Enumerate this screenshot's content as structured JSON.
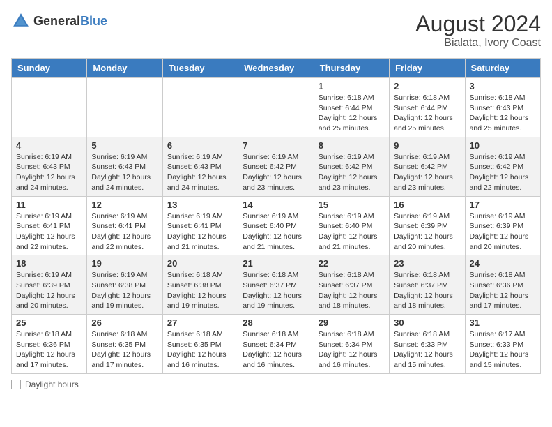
{
  "logo": {
    "text_general": "General",
    "text_blue": "Blue"
  },
  "title": "August 2024",
  "subtitle": "Bialata, Ivory Coast",
  "days_of_week": [
    "Sunday",
    "Monday",
    "Tuesday",
    "Wednesday",
    "Thursday",
    "Friday",
    "Saturday"
  ],
  "footer_label": "Daylight hours",
  "weeks": [
    [
      {
        "day": "",
        "info": ""
      },
      {
        "day": "",
        "info": ""
      },
      {
        "day": "",
        "info": ""
      },
      {
        "day": "",
        "info": ""
      },
      {
        "day": "1",
        "info": "Sunrise: 6:18 AM\nSunset: 6:44 PM\nDaylight: 12 hours\nand 25 minutes."
      },
      {
        "day": "2",
        "info": "Sunrise: 6:18 AM\nSunset: 6:44 PM\nDaylight: 12 hours\nand 25 minutes."
      },
      {
        "day": "3",
        "info": "Sunrise: 6:18 AM\nSunset: 6:43 PM\nDaylight: 12 hours\nand 25 minutes."
      }
    ],
    [
      {
        "day": "4",
        "info": "Sunrise: 6:19 AM\nSunset: 6:43 PM\nDaylight: 12 hours\nand 24 minutes."
      },
      {
        "day": "5",
        "info": "Sunrise: 6:19 AM\nSunset: 6:43 PM\nDaylight: 12 hours\nand 24 minutes."
      },
      {
        "day": "6",
        "info": "Sunrise: 6:19 AM\nSunset: 6:43 PM\nDaylight: 12 hours\nand 24 minutes."
      },
      {
        "day": "7",
        "info": "Sunrise: 6:19 AM\nSunset: 6:42 PM\nDaylight: 12 hours\nand 23 minutes."
      },
      {
        "day": "8",
        "info": "Sunrise: 6:19 AM\nSunset: 6:42 PM\nDaylight: 12 hours\nand 23 minutes."
      },
      {
        "day": "9",
        "info": "Sunrise: 6:19 AM\nSunset: 6:42 PM\nDaylight: 12 hours\nand 23 minutes."
      },
      {
        "day": "10",
        "info": "Sunrise: 6:19 AM\nSunset: 6:42 PM\nDaylight: 12 hours\nand 22 minutes."
      }
    ],
    [
      {
        "day": "11",
        "info": "Sunrise: 6:19 AM\nSunset: 6:41 PM\nDaylight: 12 hours\nand 22 minutes."
      },
      {
        "day": "12",
        "info": "Sunrise: 6:19 AM\nSunset: 6:41 PM\nDaylight: 12 hours\nand 22 minutes."
      },
      {
        "day": "13",
        "info": "Sunrise: 6:19 AM\nSunset: 6:41 PM\nDaylight: 12 hours\nand 21 minutes."
      },
      {
        "day": "14",
        "info": "Sunrise: 6:19 AM\nSunset: 6:40 PM\nDaylight: 12 hours\nand 21 minutes."
      },
      {
        "day": "15",
        "info": "Sunrise: 6:19 AM\nSunset: 6:40 PM\nDaylight: 12 hours\nand 21 minutes."
      },
      {
        "day": "16",
        "info": "Sunrise: 6:19 AM\nSunset: 6:39 PM\nDaylight: 12 hours\nand 20 minutes."
      },
      {
        "day": "17",
        "info": "Sunrise: 6:19 AM\nSunset: 6:39 PM\nDaylight: 12 hours\nand 20 minutes."
      }
    ],
    [
      {
        "day": "18",
        "info": "Sunrise: 6:19 AM\nSunset: 6:39 PM\nDaylight: 12 hours\nand 20 minutes."
      },
      {
        "day": "19",
        "info": "Sunrise: 6:19 AM\nSunset: 6:38 PM\nDaylight: 12 hours\nand 19 minutes."
      },
      {
        "day": "20",
        "info": "Sunrise: 6:18 AM\nSunset: 6:38 PM\nDaylight: 12 hours\nand 19 minutes."
      },
      {
        "day": "21",
        "info": "Sunrise: 6:18 AM\nSunset: 6:37 PM\nDaylight: 12 hours\nand 19 minutes."
      },
      {
        "day": "22",
        "info": "Sunrise: 6:18 AM\nSunset: 6:37 PM\nDaylight: 12 hours\nand 18 minutes."
      },
      {
        "day": "23",
        "info": "Sunrise: 6:18 AM\nSunset: 6:37 PM\nDaylight: 12 hours\nand 18 minutes."
      },
      {
        "day": "24",
        "info": "Sunrise: 6:18 AM\nSunset: 6:36 PM\nDaylight: 12 hours\nand 17 minutes."
      }
    ],
    [
      {
        "day": "25",
        "info": "Sunrise: 6:18 AM\nSunset: 6:36 PM\nDaylight: 12 hours\nand 17 minutes."
      },
      {
        "day": "26",
        "info": "Sunrise: 6:18 AM\nSunset: 6:35 PM\nDaylight: 12 hours\nand 17 minutes."
      },
      {
        "day": "27",
        "info": "Sunrise: 6:18 AM\nSunset: 6:35 PM\nDaylight: 12 hours\nand 16 minutes."
      },
      {
        "day": "28",
        "info": "Sunrise: 6:18 AM\nSunset: 6:34 PM\nDaylight: 12 hours\nand 16 minutes."
      },
      {
        "day": "29",
        "info": "Sunrise: 6:18 AM\nSunset: 6:34 PM\nDaylight: 12 hours\nand 16 minutes."
      },
      {
        "day": "30",
        "info": "Sunrise: 6:18 AM\nSunset: 6:33 PM\nDaylight: 12 hours\nand 15 minutes."
      },
      {
        "day": "31",
        "info": "Sunrise: 6:17 AM\nSunset: 6:33 PM\nDaylight: 12 hours\nand 15 minutes."
      }
    ]
  ]
}
